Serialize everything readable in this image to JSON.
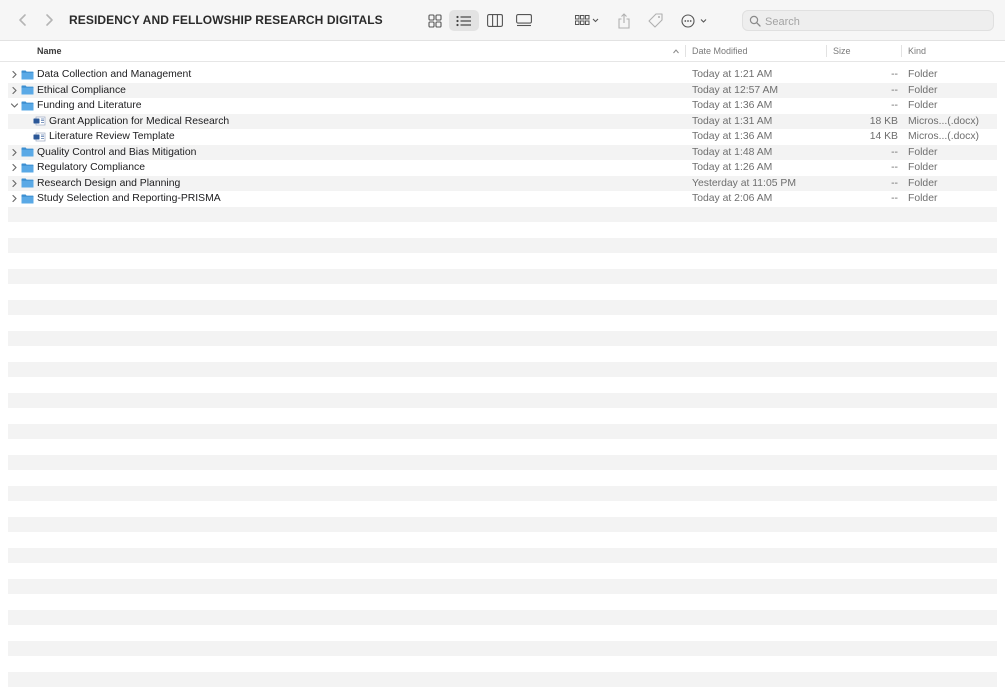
{
  "window": {
    "title": "RESIDENCY AND FELLOWSHIP RESEARCH DIGITALS"
  },
  "toolbar": {
    "search_placeholder": "Search",
    "icons": [
      "chevron-left-icon",
      "chevron-right-icon",
      "grid-view-icon",
      "list-view-icon",
      "column-view-icon",
      "gallery-view-icon",
      "group-icon",
      "share-icon",
      "tag-icon",
      "more-actions-icon",
      "search-icon"
    ]
  },
  "columns": {
    "name": "Name",
    "date": "Date Modified",
    "size": "Size",
    "kind": "Kind"
  },
  "rows": [
    {
      "name": "Data Collection and Management",
      "date": "Today at 1:21 AM",
      "size": "--",
      "kind": "Folder",
      "type": "folder",
      "expanded": false
    },
    {
      "name": "Ethical Compliance",
      "date": "Today at 12:57 AM",
      "size": "--",
      "kind": "Folder",
      "type": "folder",
      "expanded": false
    },
    {
      "name": "Funding and Literature",
      "date": "Today at 1:36 AM",
      "size": "--",
      "kind": "Folder",
      "type": "folder",
      "expanded": true
    },
    {
      "name": "Grant Application for Medical Research",
      "date": "Today at 1:31 AM",
      "size": "18 KB",
      "kind": "Micros...(.docx)",
      "type": "doc",
      "indent": 1
    },
    {
      "name": "Literature Review Template",
      "date": "Today at 1:36 AM",
      "size": "14 KB",
      "kind": "Micros...(.docx)",
      "type": "doc",
      "indent": 1
    },
    {
      "name": "Quality Control and Bias Mitigation",
      "date": "Today at 1:48 AM",
      "size": "--",
      "kind": "Folder",
      "type": "folder",
      "expanded": false
    },
    {
      "name": "Regulatory Compliance",
      "date": "Today at 1:26 AM",
      "size": "--",
      "kind": "Folder",
      "type": "folder",
      "expanded": false
    },
    {
      "name": "Research Design and Planning",
      "date": "Yesterday at 11:05 PM",
      "size": "--",
      "kind": "Folder",
      "type": "folder",
      "expanded": false
    },
    {
      "name": "Study Selection and Reporting-PRISMA",
      "date": "Today at 2:06 AM",
      "size": "--",
      "kind": "Folder",
      "type": "folder",
      "expanded": false
    }
  ],
  "colors": {
    "folder": "#5aa9e6",
    "folder_dark": "#3d8fd1",
    "doc": "#2b5797",
    "stripe": "#f3f3f3"
  }
}
